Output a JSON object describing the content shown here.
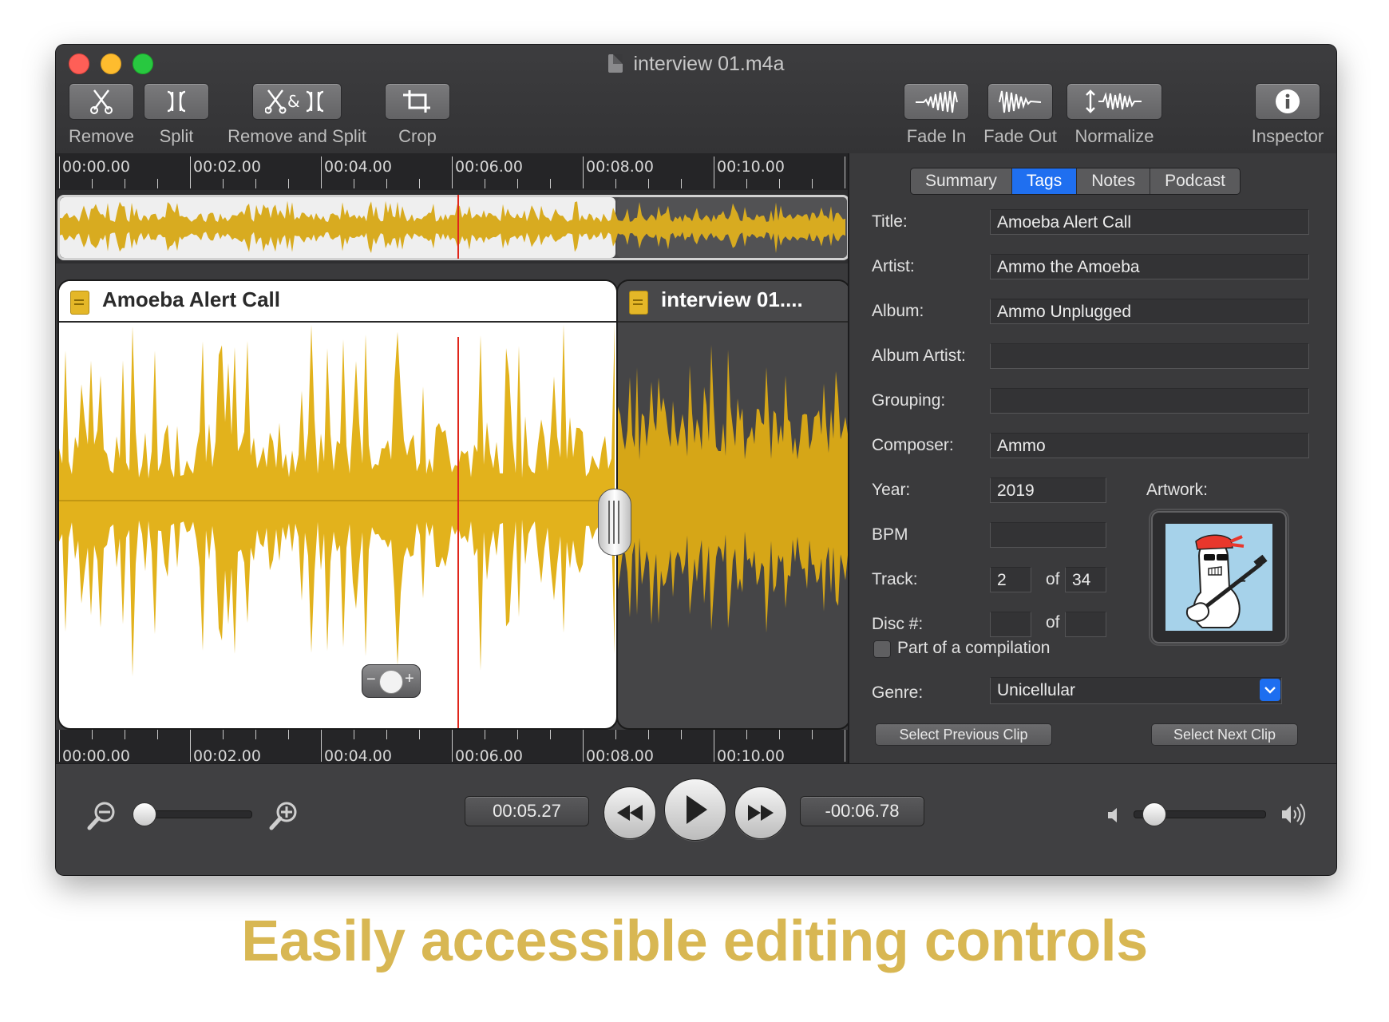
{
  "window": {
    "title": "interview 01.m4a"
  },
  "toolbar": {
    "left": [
      {
        "label": "Remove",
        "icon": "scissors-icon"
      },
      {
        "label": "Split",
        "icon": "split-icon"
      },
      {
        "label": "Remove and Split",
        "icon": "remove-and-split-icon"
      },
      {
        "label": "Crop",
        "icon": "crop-icon"
      }
    ],
    "right": [
      {
        "label": "Fade In",
        "icon": "fade-in-icon"
      },
      {
        "label": "Fade Out",
        "icon": "fade-out-icon"
      },
      {
        "label": "Normalize",
        "icon": "normalize-icon"
      },
      {
        "label": "Inspector",
        "icon": "info-icon"
      }
    ]
  },
  "timeline": {
    "ticks": [
      "00:00.00",
      "00:02.00",
      "00:04.00",
      "00:06.00",
      "00:08.00",
      "00:10.00"
    ]
  },
  "clips": [
    {
      "name": "Amoeba Alert Call",
      "selected": true
    },
    {
      "name": "interview 01....",
      "selected": false
    }
  ],
  "colors": {
    "waveform": "#e2b21c",
    "playhead": "#e0261b",
    "accent": "#1f6ff0",
    "caption": "#d8b753"
  },
  "inspector": {
    "tabs": [
      "Summary",
      "Tags",
      "Notes",
      "Podcast"
    ],
    "active_tab": "Tags",
    "fields": {
      "title": {
        "label": "Title:",
        "value": "Amoeba Alert Call"
      },
      "artist": {
        "label": "Artist:",
        "value": "Ammo the Amoeba"
      },
      "album": {
        "label": "Album:",
        "value": "Ammo Unplugged"
      },
      "album_artist": {
        "label": "Album Artist:",
        "value": ""
      },
      "grouping": {
        "label": "Grouping:",
        "value": ""
      },
      "composer": {
        "label": "Composer:",
        "value": "Ammo"
      },
      "year": {
        "label": "Year:",
        "value": "2019"
      },
      "bpm": {
        "label": "BPM",
        "value": ""
      },
      "track": {
        "label": "Track:",
        "value": "2",
        "of_label": "of",
        "total": "34"
      },
      "disc": {
        "label": "Disc #:",
        "value": "",
        "of_label": "of",
        "total": ""
      },
      "genre": {
        "label": "Genre:",
        "value": "Unicellular"
      }
    },
    "artwork_label": "Artwork:",
    "compilation_label": "Part of a compilation",
    "compilation_checked": false,
    "prev_clip": "Select Previous Clip",
    "next_clip": "Select Next Clip"
  },
  "transport": {
    "elapsed": "00:05.27",
    "remaining": "-00:06.78",
    "zoom_level": 0.0,
    "volume_level": 0.08
  },
  "caption": "Easily accessible editing controls"
}
